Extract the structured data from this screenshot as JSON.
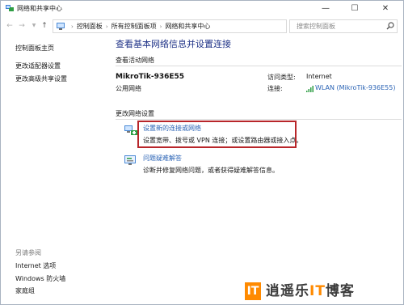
{
  "window": {
    "title": "网络和共享中心"
  },
  "title_controls": {
    "minimize": "—",
    "maximize": "☐",
    "close": "✕"
  },
  "address": {
    "crumbs": [
      "控制面板",
      "所有控制面板项",
      "网络和共享中心"
    ]
  },
  "search": {
    "placeholder": "搜索控制面板"
  },
  "sidebar": {
    "home": "控制面板主页",
    "links": [
      "更改适配器设置",
      "更改高级共享设置"
    ],
    "see_also_heading": "另请参阅",
    "see_also": [
      "Internet 选项",
      "Windows 防火墙",
      "家庭组"
    ]
  },
  "main": {
    "heading": "查看基本网络信息并设置连接",
    "active_section": "查看活动网络",
    "network_name": "MikroTik-936E55",
    "network_type": "公用网络",
    "access_type_label": "访问类型:",
    "access_type_value": "Internet",
    "connection_label": "连接:",
    "connection_value": "WLAN (MikroTik-936E55)",
    "change_section": "更改网络设置",
    "tasks": [
      {
        "link": "设置新的连接或网络",
        "desc": "设置宽带、拨号或 VPN 连接；或设置路由器或接入点。"
      },
      {
        "link": "问题疑难解答",
        "desc": "诊断并修复网络问题，或者获得疑难解答信息。"
      }
    ]
  },
  "watermark": {
    "mark": "IT",
    "text_pre": "逍遥乐",
    "text_it": "IT",
    "text_post": "博客"
  },
  "colors": {
    "link": "#2a63b5",
    "heading": "#1e3287",
    "highlight": "#b8262a",
    "brand": "#ff8a00"
  }
}
